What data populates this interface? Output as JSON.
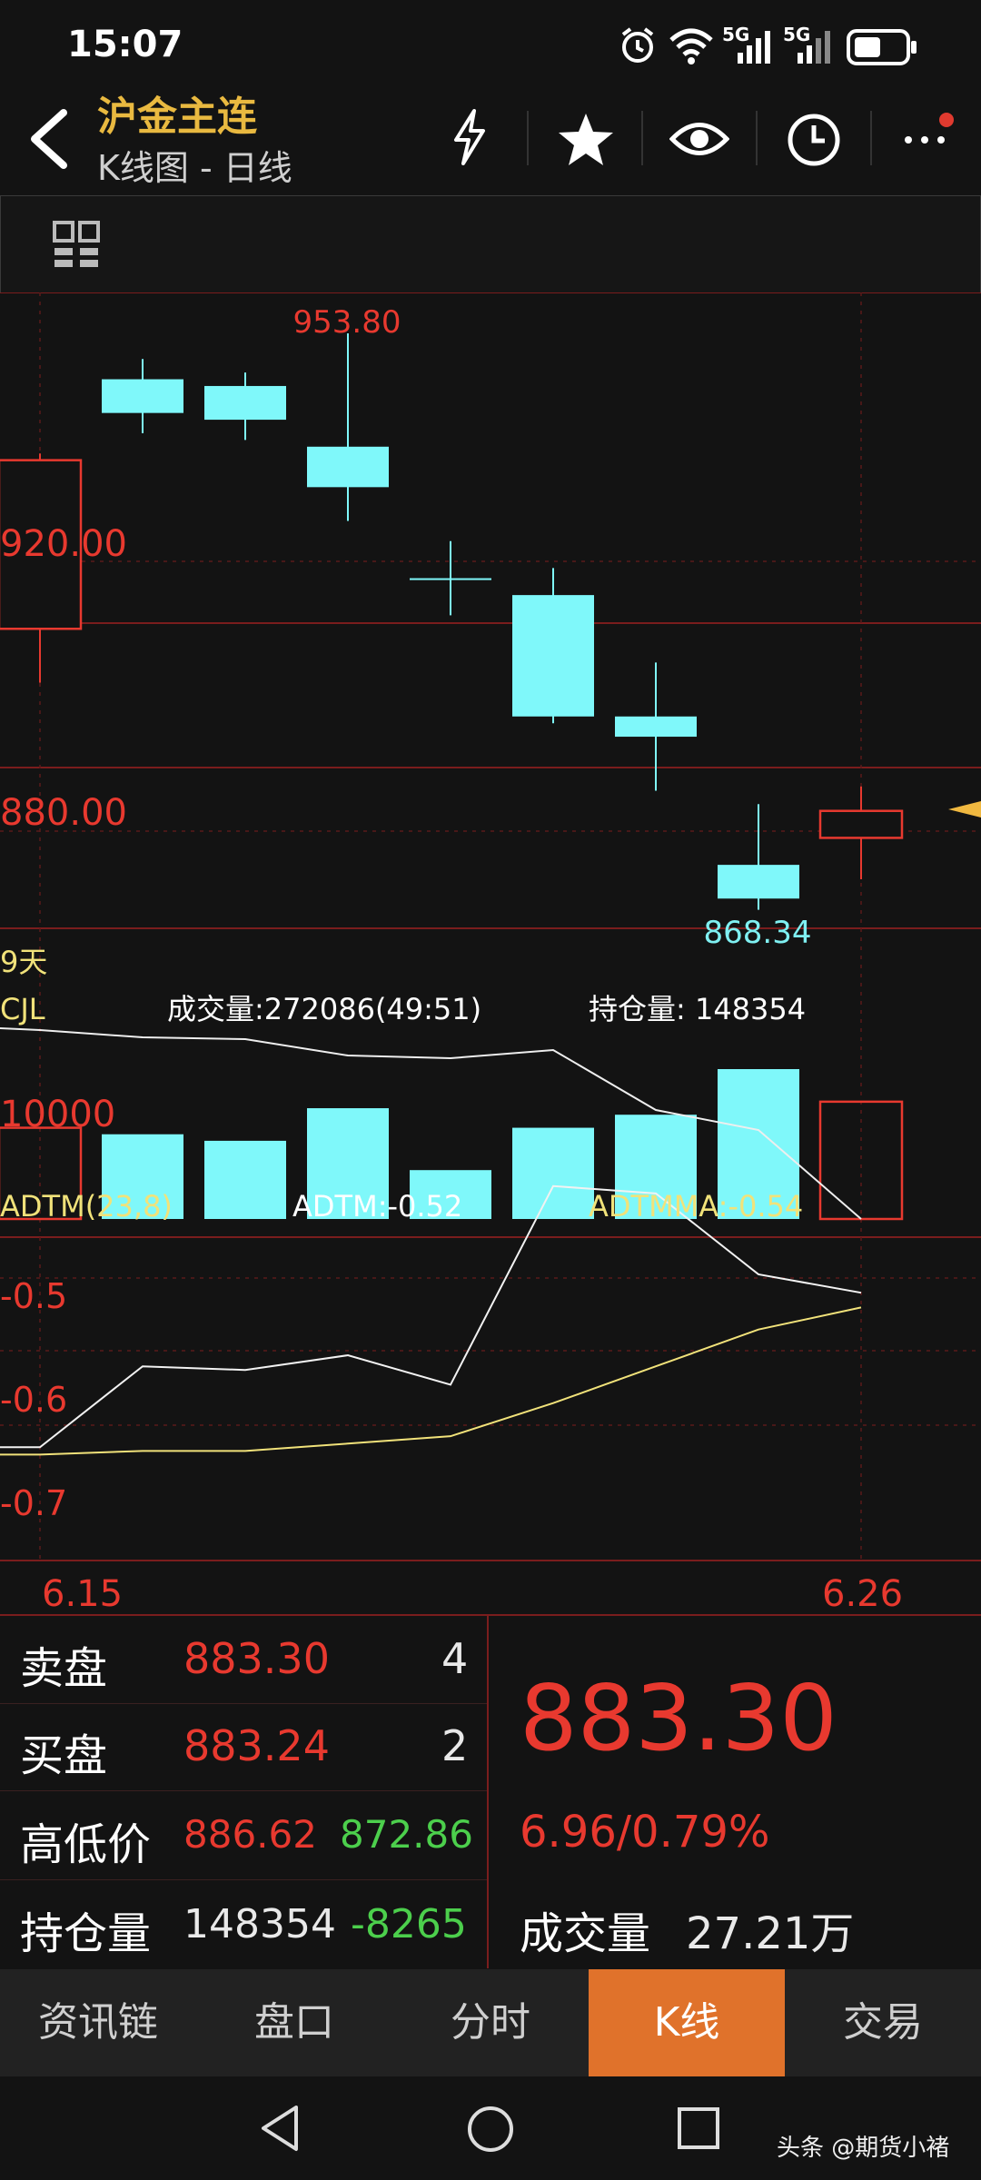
{
  "status": {
    "time": "15:07",
    "net1": "5G",
    "net2": "5G"
  },
  "header": {
    "title": "沪金主连",
    "subtitle": "K线图 - 日线"
  },
  "chart": {
    "price_labels": [
      "953.80",
      "920.00",
      "880.00",
      "868.34"
    ],
    "period_label": "9天",
    "volume": {
      "name": "CJL",
      "info": "成交量:272086(49:51)",
      "oi": "持仓量: 148354",
      "axis": "10000"
    },
    "adtm": {
      "name": "ADTM(23,8)",
      "value": "ADTM:-0.52",
      "ma": "ADTMMA:-0.54",
      "ticks": [
        "-0.5",
        "-0.6",
        "-0.7"
      ]
    },
    "dates": [
      "6.15",
      "6.26"
    ]
  },
  "chart_data": {
    "type": "candlestick",
    "price_axis_ticks": [
      920.0,
      880.0
    ],
    "high_label": 953.8,
    "low_label": 868.34,
    "candles": [
      {
        "open": 910,
        "close": 935,
        "high": 936,
        "low": 902,
        "dir": "up"
      },
      {
        "open": 942,
        "close": 947,
        "high": 950,
        "low": 939,
        "dir": "down"
      },
      {
        "open": 946,
        "close": 941,
        "high": 948,
        "low": 938,
        "dir": "down"
      },
      {
        "open": 937,
        "close": 931,
        "high": 953.8,
        "low": 926,
        "dir": "down"
      },
      {
        "open": 917.5,
        "close": 917.5,
        "high": 923,
        "low": 912,
        "dir": "down"
      },
      {
        "open": 915,
        "close": 897,
        "high": 919,
        "low": 896,
        "dir": "down"
      },
      {
        "open": 897,
        "close": 894,
        "high": 905,
        "low": 886,
        "dir": "down"
      },
      {
        "open": 875,
        "close": 870,
        "high": 884,
        "low": 868.34,
        "dir": "down"
      },
      {
        "open": 879,
        "close": 883,
        "high": 886.62,
        "low": 872.86,
        "dir": "up"
      }
    ],
    "volume_series": [
      14000,
      13000,
      12000,
      17000,
      7500,
      14000,
      16000,
      23000,
      18000
    ],
    "adtm_series": [
      -0.73,
      -0.62,
      -0.625,
      -0.605,
      -0.645,
      -0.375,
      -0.385,
      -0.495,
      -0.52
    ],
    "adtmma_series": [
      -0.74,
      -0.735,
      -0.735,
      -0.725,
      -0.715,
      -0.67,
      -0.62,
      -0.57,
      -0.54
    ]
  },
  "quote": {
    "sell_label": "卖盘",
    "sell_price": "883.30",
    "sell_qty": "4",
    "buy_label": "买盘",
    "buy_price": "883.24",
    "buy_qty": "2",
    "hilo_label": "高低价",
    "high": "886.62",
    "low": "872.86",
    "oi_label": "持仓量",
    "oi": "148354",
    "oi_change": "-8265",
    "last": "883.30",
    "change": "6.96/0.79%",
    "vol_label": "成交量",
    "vol": "27.21万"
  },
  "tabs": [
    {
      "label": "资讯链"
    },
    {
      "label": "盘口"
    },
    {
      "label": "分时"
    },
    {
      "label": "K线"
    },
    {
      "label": "交易"
    }
  ],
  "watermark": "头条 @期货小褚"
}
